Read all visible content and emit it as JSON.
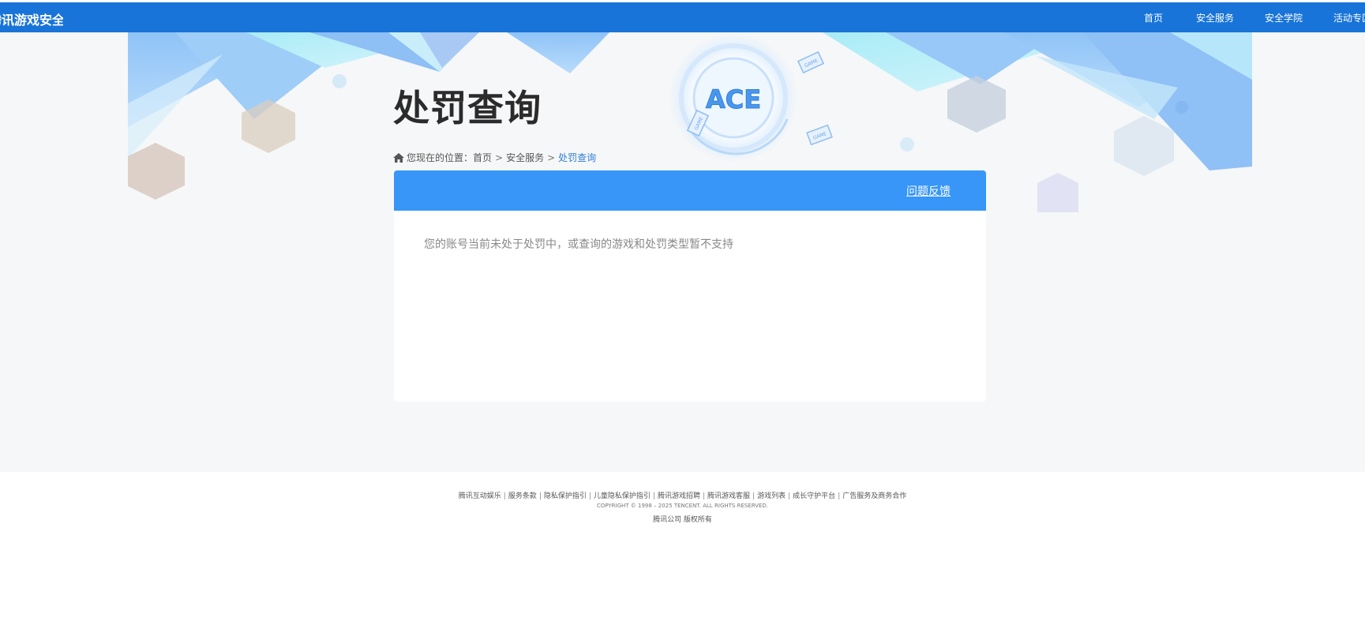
{
  "header": {
    "brand": "腾讯游戏安全",
    "nav": [
      {
        "label": "首页"
      },
      {
        "label": "安全服务"
      },
      {
        "label": "安全学院"
      },
      {
        "label": "活动专区"
      }
    ]
  },
  "hero": {
    "logo_text": "ACE",
    "badge_texts": [
      "GAME",
      "GAME",
      "GAME"
    ]
  },
  "page": {
    "title": "处罚查询",
    "breadcrumb": {
      "prefix": "您现在的位置：",
      "items": [
        "首页",
        "安全服务"
      ],
      "current": "处罚查询"
    }
  },
  "panel": {
    "feedback_link": "问题反馈",
    "message": "您的账号当前未处于处罚中，或查询的游戏和处罚类型暂不支持"
  },
  "footer": {
    "links": [
      "腾讯互动娱乐",
      "服务条款",
      "隐私保护指引",
      "儿童隐私保护指引",
      "腾讯游戏招聘",
      "腾讯游戏客服",
      "游戏列表",
      "成长守护平台",
      "广告服务及商务合作"
    ],
    "copyright": "COPYRIGHT © 1998 – 2025 TENCENT. ALL RIGHTS RESERVED.",
    "owner": "腾讯公司 版权所有"
  },
  "colors": {
    "topbar": "#1874d8",
    "panel_header": "#3796f8",
    "breadcrumb_current": "#2e7fd6",
    "page_bg": "#f6f7f8"
  }
}
